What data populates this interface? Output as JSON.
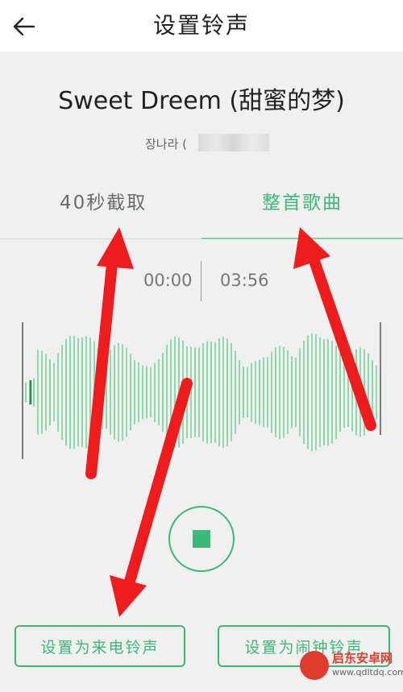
{
  "header": {
    "title": "设置铃声"
  },
  "song": {
    "title": "Sweet Dreem (甜蜜的梦)",
    "artist": "장나라 ("
  },
  "tabs": [
    {
      "label": "40秒截取",
      "active": false
    },
    {
      "label": "整首歌曲",
      "active": true
    }
  ],
  "player": {
    "current_time": "00:00",
    "total_time": "03:56"
  },
  "buttons": {
    "set_call": "设置为来电铃声",
    "set_alarm": "设置为闹钟铃声"
  },
  "watermark": {
    "name": "启东安卓网",
    "url": "www.qdltdq.com"
  },
  "colors": {
    "accent": "#3cb878",
    "arrow": "#ee1c1c",
    "header_bg": "#ffffff",
    "page_bg": "#f0f0f0"
  },
  "icons": {
    "back": "arrow-left-icon",
    "stop": "stop-icon"
  }
}
